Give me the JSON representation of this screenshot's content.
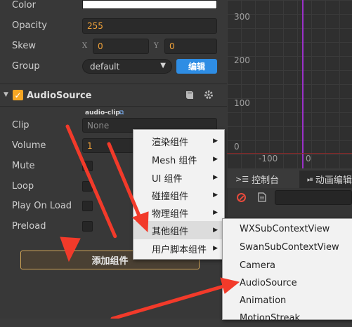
{
  "inspector": {
    "props": {
      "color_label": "Color",
      "opacity_label": "Opacity",
      "opacity_value": "255",
      "skew_label": "Skew",
      "skew_x_tag": "X",
      "skew_x_value": "0",
      "skew_y_tag": "Y",
      "skew_y_value": "0",
      "group_label": "Group",
      "group_value": "default",
      "edit_button": "编辑"
    },
    "component": {
      "title": "AudioSource",
      "clip_label": "Clip",
      "clip_tag": "audio-clip",
      "clip_value": "None",
      "volume_label": "Volume",
      "volume_value": "1",
      "mute_label": "Mute",
      "loop_label": "Loop",
      "play_on_load_label": "Play On Load",
      "preload_label": "Preload"
    },
    "add_component_button": "添加组件"
  },
  "scene": {
    "y_labels": [
      "300",
      "200",
      "100",
      "0"
    ],
    "x_labels": [
      "-100",
      "0"
    ]
  },
  "console": {
    "tab_console": "控制台",
    "tab_animation": "动画编辑"
  },
  "context_menu": {
    "items": [
      {
        "label": "渲染组件"
      },
      {
        "label": "Mesh 组件"
      },
      {
        "label": "UI 组件"
      },
      {
        "label": "碰撞组件"
      },
      {
        "label": "物理组件"
      },
      {
        "label": "其他组件"
      },
      {
        "label": "用户脚本组件"
      }
    ],
    "submenu": [
      {
        "label": "WXSubContextView"
      },
      {
        "label": "SwanSubContextView"
      },
      {
        "label": "Camera"
      },
      {
        "label": "AudioSource"
      },
      {
        "label": "Animation"
      },
      {
        "label": "MotionStreak"
      }
    ]
  },
  "colors": {
    "accent_orange": "#f0a23a",
    "button_blue": "#2e8de4",
    "annotation_red": "#f23a2a"
  }
}
